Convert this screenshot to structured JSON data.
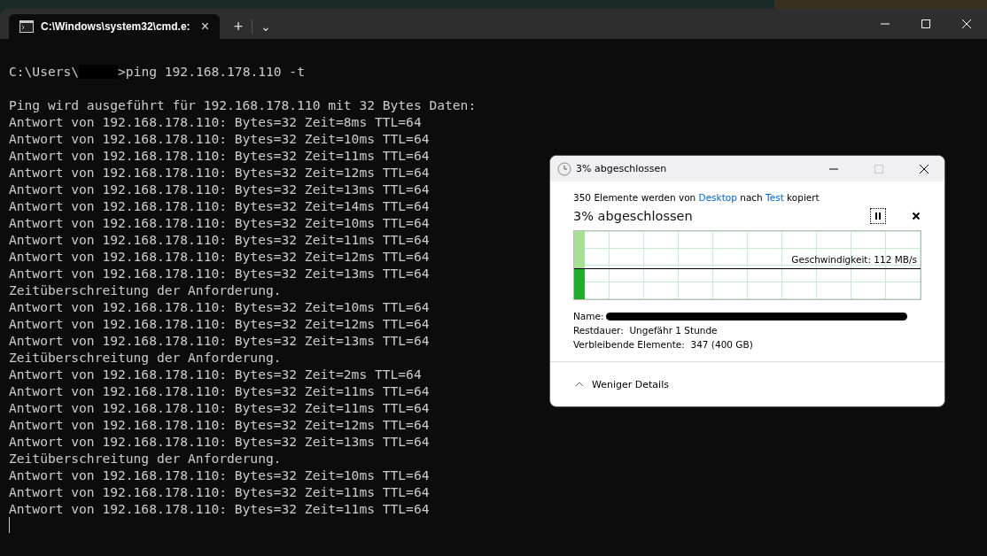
{
  "tab": {
    "title": "C:\\Windows\\system32\\cmd.e:",
    "close": "×"
  },
  "tab_bar": {
    "new_tab": "+",
    "dropdown": "⌄"
  },
  "prompt": {
    "path": "C:\\Users\\",
    "command": ">ping 192.168.178.110 -t"
  },
  "output": [
    "Ping wird ausgeführt für 192.168.178.110 mit 32 Bytes Daten:",
    "Antwort von 192.168.178.110: Bytes=32 Zeit=8ms TTL=64",
    "Antwort von 192.168.178.110: Bytes=32 Zeit=10ms TTL=64",
    "Antwort von 192.168.178.110: Bytes=32 Zeit=11ms TTL=64",
    "Antwort von 192.168.178.110: Bytes=32 Zeit=12ms TTL=64",
    "Antwort von 192.168.178.110: Bytes=32 Zeit=13ms TTL=64",
    "Antwort von 192.168.178.110: Bytes=32 Zeit=14ms TTL=64",
    "Antwort von 192.168.178.110: Bytes=32 Zeit=10ms TTL=64",
    "Antwort von 192.168.178.110: Bytes=32 Zeit=11ms TTL=64",
    "Antwort von 192.168.178.110: Bytes=32 Zeit=12ms TTL=64",
    "Antwort von 192.168.178.110: Bytes=32 Zeit=13ms TTL=64",
    "Zeitüberschreitung der Anforderung.",
    "Antwort von 192.168.178.110: Bytes=32 Zeit=10ms TTL=64",
    "Antwort von 192.168.178.110: Bytes=32 Zeit=12ms TTL=64",
    "Antwort von 192.168.178.110: Bytes=32 Zeit=13ms TTL=64",
    "Zeitüberschreitung der Anforderung.",
    "Antwort von 192.168.178.110: Bytes=32 Zeit=2ms TTL=64",
    "Antwort von 192.168.178.110: Bytes=32 Zeit=11ms TTL=64",
    "Antwort von 192.168.178.110: Bytes=32 Zeit=11ms TTL=64",
    "Antwort von 192.168.178.110: Bytes=32 Zeit=12ms TTL=64",
    "Antwort von 192.168.178.110: Bytes=32 Zeit=13ms TTL=64",
    "Zeitüberschreitung der Anforderung.",
    "Antwort von 192.168.178.110: Bytes=32 Zeit=10ms TTL=64",
    "Antwort von 192.168.178.110: Bytes=32 Zeit=11ms TTL=64",
    "Antwort von 192.168.178.110: Bytes=32 Zeit=11ms TTL=64"
  ],
  "copy_dialog": {
    "title": "3% abgeschlossen",
    "summary": {
      "count": "350 Elemente werden von",
      "source": "Desktop",
      "middle": "nach",
      "target": "Test",
      "end": "kopiert"
    },
    "heading": "3% abgeschlossen",
    "progress": {
      "level": 0.03,
      "speed": "Geschwindigkeit: 112 MB/s"
    },
    "name_label": "Name:",
    "remaining_time": "Restdauer:  Ungefähr 1 Stunde",
    "remaining_items": "Verbleibende Elemente:  347 (400 GB)",
    "less_details": "Weniger Details"
  }
}
